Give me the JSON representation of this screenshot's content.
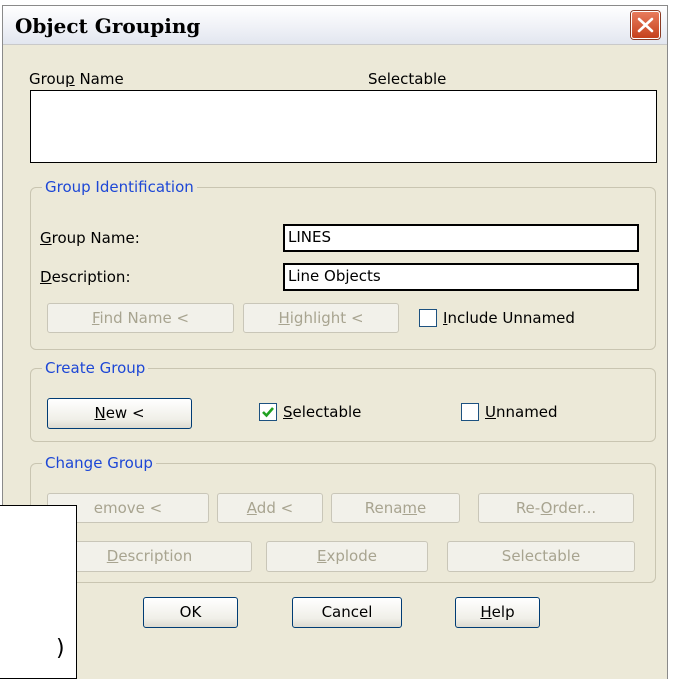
{
  "window": {
    "title": "Object Grouping"
  },
  "list": {
    "col_group_name_pre": "Grou",
    "col_group_name_ul": "p",
    "col_group_name_post": " Name",
    "col_selectable": "Selectable"
  },
  "group_identification": {
    "legend": "Group Identification",
    "group_name_label_ul": "G",
    "group_name_label_rest": "roup Name:",
    "group_name_value": "LINES",
    "description_label_ul": "D",
    "description_label_rest": "escription:",
    "description_value": "Line Objects",
    "find_name_ul": "F",
    "find_name_rest": "ind Name <",
    "highlight_ul": "H",
    "highlight_rest": "ighlight <",
    "include_unnamed_ul": "I",
    "include_unnamed_rest": "nclude Unnamed",
    "include_unnamed_checked": false
  },
  "create_group": {
    "legend": "Create Group",
    "new_ul": "N",
    "new_rest": "ew <",
    "selectable_ul": "S",
    "selectable_rest": "electable",
    "selectable_checked": true,
    "unnamed_ul": "U",
    "unnamed_rest": "nnamed",
    "unnamed_checked": false
  },
  "change_group": {
    "legend": "Change Group",
    "remove_partial": "emove <",
    "add_ul": "A",
    "add_rest": "dd <",
    "rename_pre": "Rena",
    "rename_ul": "m",
    "rename_post": "e",
    "reorder_pre": "Re-",
    "reorder_ul": "O",
    "reorder_post": "rder...",
    "description_ul": "D",
    "description_rest": "escription",
    "explode_ul": "E",
    "explode_rest": "xplode",
    "selectable": "Selectable"
  },
  "footer": {
    "ok": "OK",
    "cancel": "Cancel",
    "help_ul": "H",
    "help_rest": "elp"
  },
  "overlay": {
    "paren": ")"
  },
  "colors": {
    "legend": "#1d47d6",
    "dialog_bg": "#ece9d8",
    "close_red": "#c5411d",
    "check_green": "#21a121"
  }
}
